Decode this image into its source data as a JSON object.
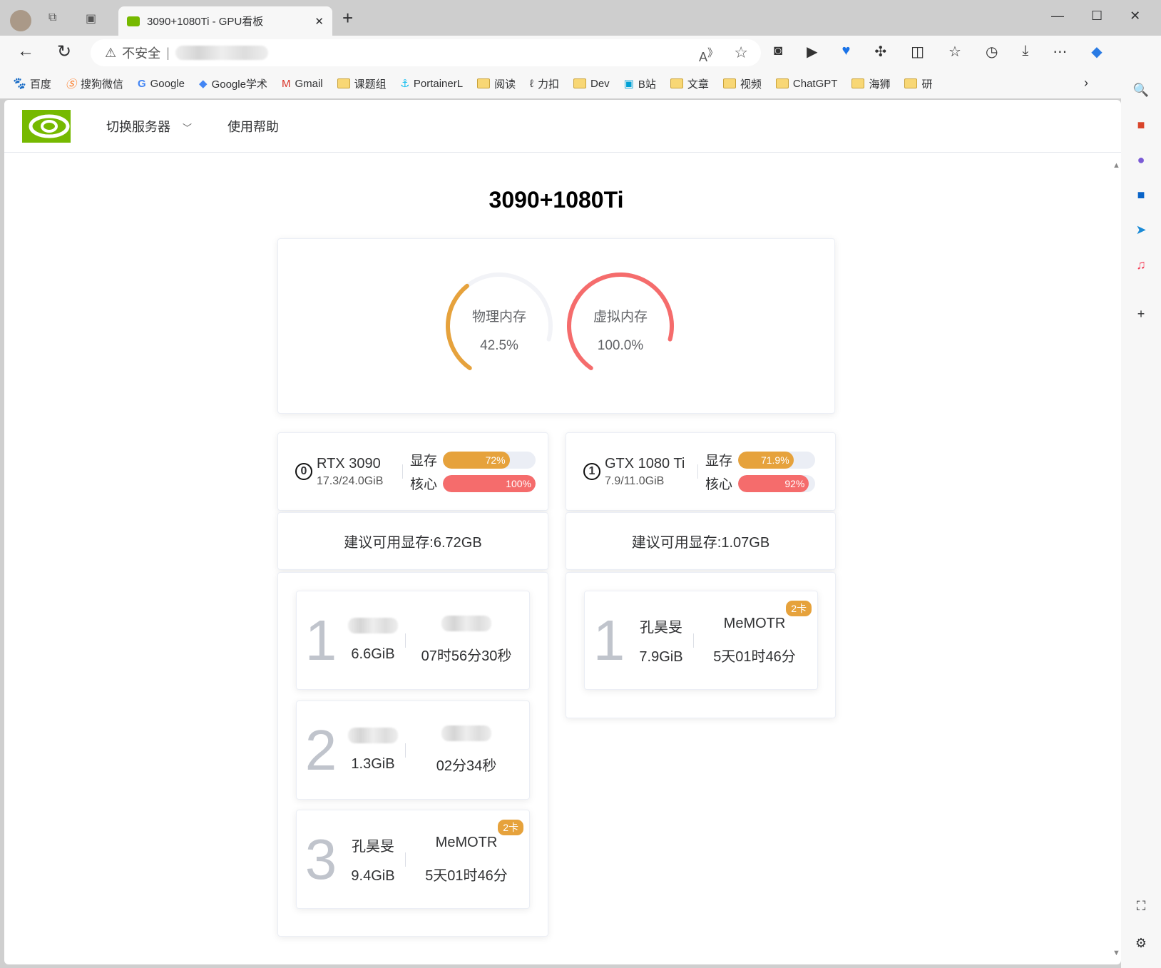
{
  "browser": {
    "tab_title": "3090+1080Ti - GPU看板",
    "security": "不安全",
    "bookmarks": [
      "百度",
      "搜狗微信",
      "Google",
      "Google学术",
      "Gmail",
      "课题组",
      "PortainerL",
      "阅读",
      "力扣",
      "Dev",
      "B站",
      "文章",
      "视频",
      "ChatGPT",
      "海狮",
      "研"
    ]
  },
  "nav": {
    "switch_server": "切换服务器",
    "help": "使用帮助"
  },
  "title": "3090+1080Ti",
  "memory": {
    "physical_label": "物理内存",
    "physical_value": "42.5%",
    "physical_pct": 42.5,
    "virtual_label": "虚拟内存",
    "virtual_value": "100.0%",
    "virtual_pct": 100
  },
  "colors": {
    "orange": "#e6a23c",
    "red": "#f56c6c",
    "green": "#76b900"
  },
  "gpus": [
    {
      "index": "0",
      "name": "RTX 3090",
      "mem": "17.3/24.0GiB",
      "mem_label": "显存",
      "mem_pct": "72%",
      "mem_val": 72,
      "core_label": "核心",
      "core_pct": "100%",
      "core_val": 100,
      "suggest": "建议可用显存:6.72GB",
      "procs": [
        {
          "n": "1",
          "user": "",
          "mem": "6.6GiB",
          "proj": "",
          "time": "07时56分30秒"
        },
        {
          "n": "2",
          "user": "",
          "mem": "1.3GiB",
          "proj": "",
          "time": "02分34秒"
        },
        {
          "n": "3",
          "user": "孔昊旻",
          "mem": "9.4GiB",
          "proj": "MeMOTR",
          "time": "5天01时46分",
          "badge": "2卡"
        }
      ]
    },
    {
      "index": "1",
      "name": "GTX 1080 Ti",
      "mem": "7.9/11.0GiB",
      "mem_label": "显存",
      "mem_pct": "71.9%",
      "mem_val": 71.9,
      "core_label": "核心",
      "core_pct": "92%",
      "core_val": 92,
      "suggest": "建议可用显存:1.07GB",
      "procs": [
        {
          "n": "1",
          "user": "孔昊旻",
          "mem": "7.9GiB",
          "proj": "MeMOTR",
          "time": "5天01时46分",
          "badge": "2卡"
        }
      ]
    }
  ]
}
